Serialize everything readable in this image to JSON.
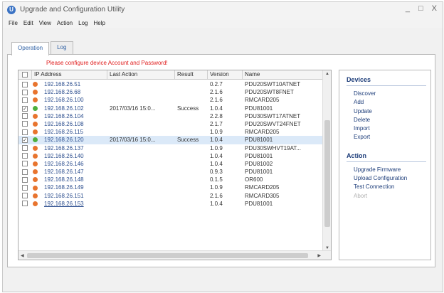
{
  "window": {
    "title": "Upgrade and Configuration Utility",
    "controls": [
      "_",
      "□",
      "X"
    ]
  },
  "menu": [
    "File",
    "Edit",
    "View",
    "Action",
    "Log",
    "Help"
  ],
  "tabs": [
    {
      "label": "Operation",
      "active": true
    },
    {
      "label": "Log",
      "active": false
    }
  ],
  "warning": "Please configure device Account and Password!",
  "columns": {
    "ip": "IP Address",
    "action": "Last Action",
    "result": "Result",
    "version": "Version",
    "name": "Name"
  },
  "rows": [
    {
      "checked": false,
      "status_color": "#e8742e",
      "ip": "192.168.26.51",
      "action": "",
      "result": "",
      "version": "0.2.7",
      "name": "PDU20SWT10ATNET"
    },
    {
      "checked": false,
      "status_color": "#e8742e",
      "ip": "192.168.26.68",
      "action": "",
      "result": "",
      "version": "2.1.6",
      "name": "PDU20SWT8FNET"
    },
    {
      "checked": false,
      "status_color": "#e8742e",
      "ip": "192.168.26.100",
      "action": "",
      "result": "",
      "version": "2.1.6",
      "name": "RMCARD205"
    },
    {
      "checked": true,
      "status_color": "#4caf3d",
      "ip": "192.168.26.102",
      "action": "2017/03/16 15:0...",
      "result": "Success",
      "version": "1.0.4",
      "name": "PDU81001"
    },
    {
      "checked": false,
      "status_color": "#e8742e",
      "ip": "192.168.26.104",
      "action": "",
      "result": "",
      "version": "2.2.8",
      "name": "PDU30SWT17ATNET"
    },
    {
      "checked": false,
      "status_color": "#e8742e",
      "ip": "192.168.26.108",
      "action": "",
      "result": "",
      "version": "2.1.7",
      "name": "PDU20SWVT24FNET"
    },
    {
      "checked": false,
      "status_color": "#e8742e",
      "ip": "192.168.26.115",
      "action": "",
      "result": "",
      "version": "1.0.9",
      "name": "RMCARD205"
    },
    {
      "checked": true,
      "status_color": "#4caf3d",
      "ip": "192.168.26.120",
      "action": "2017/03/16 15:0...",
      "result": "Success",
      "version": "1.0.4",
      "name": "PDU81001",
      "highlight": true
    },
    {
      "checked": false,
      "status_color": "#e8742e",
      "ip": "192.168.26.137",
      "action": "",
      "result": "",
      "version": "1.0.9",
      "name": "PDU30SWHVT19AT..."
    },
    {
      "checked": false,
      "status_color": "#e8742e",
      "ip": "192.168.26.140",
      "action": "",
      "result": "",
      "version": "1.0.4",
      "name": "PDU81001"
    },
    {
      "checked": false,
      "status_color": "#e8742e",
      "ip": "192.168.26.146",
      "action": "",
      "result": "",
      "version": "1.0.4",
      "name": "PDU81002"
    },
    {
      "checked": false,
      "status_color": "#e8742e",
      "ip": "192.168.26.147",
      "action": "",
      "result": "",
      "version": "0.9.3",
      "name": "PDU81001"
    },
    {
      "checked": false,
      "status_color": "#e8742e",
      "ip": "192.168.26.148",
      "action": "",
      "result": "",
      "version": "0.1.5",
      "name": "OR600"
    },
    {
      "checked": false,
      "status_color": "#e8742e",
      "ip": "192.168.26.149",
      "action": "",
      "result": "",
      "version": "1.0.9",
      "name": "RMCARD205"
    },
    {
      "checked": false,
      "status_color": "#e8742e",
      "ip": "192.168.26.151",
      "action": "",
      "result": "",
      "version": "2.1.6",
      "name": "RMCARD305"
    },
    {
      "checked": false,
      "status_color": "#e8742e",
      "ip": "192.168.26.153",
      "action": "",
      "result": "",
      "version": "1.0.4",
      "name": "PDU81001",
      "underline": true
    }
  ],
  "sidepanel": {
    "devices_title": "Devices",
    "devices": [
      {
        "label": "Discover",
        "enabled": true
      },
      {
        "label": "Add",
        "enabled": true
      },
      {
        "label": "Update",
        "enabled": true
      },
      {
        "label": "Delete",
        "enabled": true
      },
      {
        "label": "Import",
        "enabled": true
      },
      {
        "label": "Export",
        "enabled": true
      }
    ],
    "action_title": "Action",
    "actions": [
      {
        "label": "Upgrade Firmware",
        "enabled": true
      },
      {
        "label": "Upload Configuration",
        "enabled": true
      },
      {
        "label": "Test Connection",
        "enabled": true
      },
      {
        "label": "Abort",
        "enabled": false
      }
    ]
  }
}
